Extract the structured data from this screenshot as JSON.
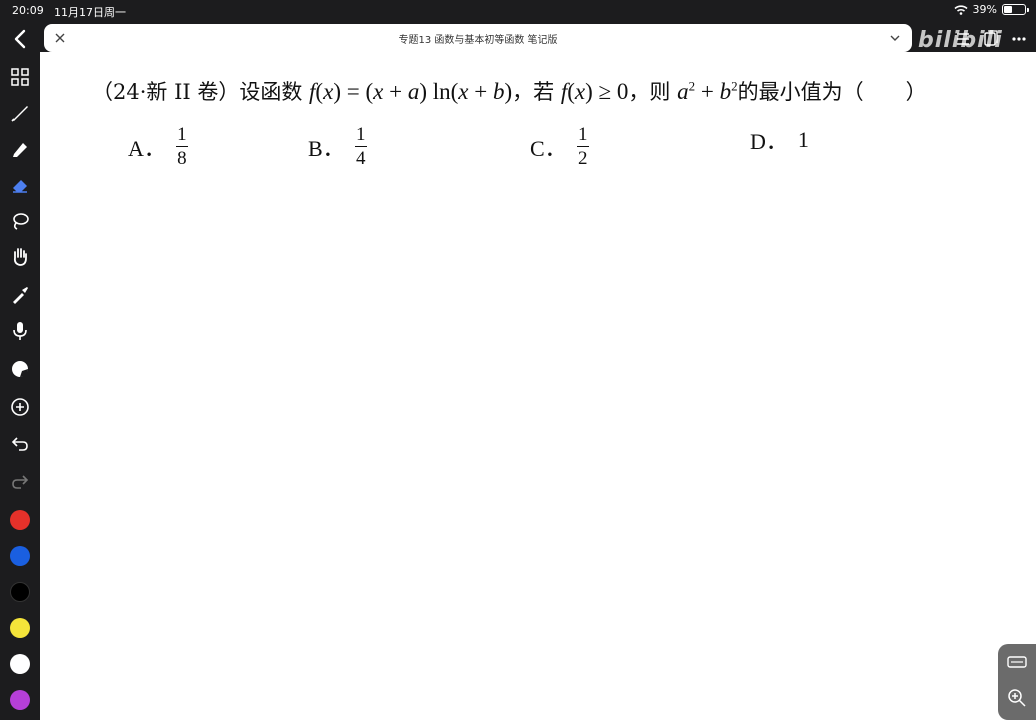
{
  "status": {
    "time": "20:09",
    "date": "11月17日周一",
    "battery": "39%",
    "battery_level": 0.39
  },
  "tab": {
    "title": "专题13 函数与基本初等函数 笔记版"
  },
  "watermark": "bilibili",
  "tools": [
    "back-icon",
    "pages-grid-icon",
    "pen-icon",
    "marker-icon",
    "eraser-icon",
    "lasso-icon",
    "hand-icon",
    "pipette-icon",
    "microphone-icon",
    "sticker-icon",
    "add-icon",
    "undo-icon",
    "redo-icon"
  ],
  "colors": [
    "#e5312a",
    "#1a5fe0",
    "#000000",
    "#f4e43a",
    "#ffffff",
    "#b63fd8"
  ],
  "question": {
    "prefix": "（24·新 II 卷）设函数",
    "cond_word": "，若",
    "then_word": "，则",
    "suffix": "的最小值为（　　）"
  },
  "options": [
    {
      "label": "A．",
      "num": "1",
      "den": "8"
    },
    {
      "label": "B．",
      "num": "1",
      "den": "4"
    },
    {
      "label": "C．",
      "num": "1",
      "den": "2"
    },
    {
      "label": "D．",
      "value": "1"
    }
  ]
}
